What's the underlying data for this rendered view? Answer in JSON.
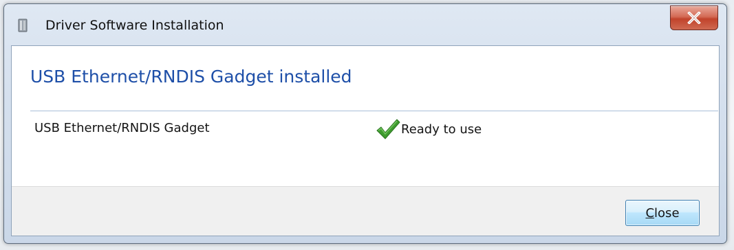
{
  "window": {
    "title": "Driver Software Installation",
    "title_icon": "driver-installer-icon",
    "close_icon": "close-icon"
  },
  "content": {
    "heading": "USB Ethernet/RNDIS Gadget installed",
    "device_name": "USB Ethernet/RNDIS Gadget",
    "status_text": "Ready to use",
    "status_icon": "checkmark-icon"
  },
  "footer": {
    "close_label_mnemonic": "C",
    "close_label_rest": "lose"
  },
  "colors": {
    "heading": "#1e4fa8",
    "checkmark": "#3e9b2e",
    "close_x_button": "#c1432b",
    "close_button_border": "#3c7fb1"
  }
}
